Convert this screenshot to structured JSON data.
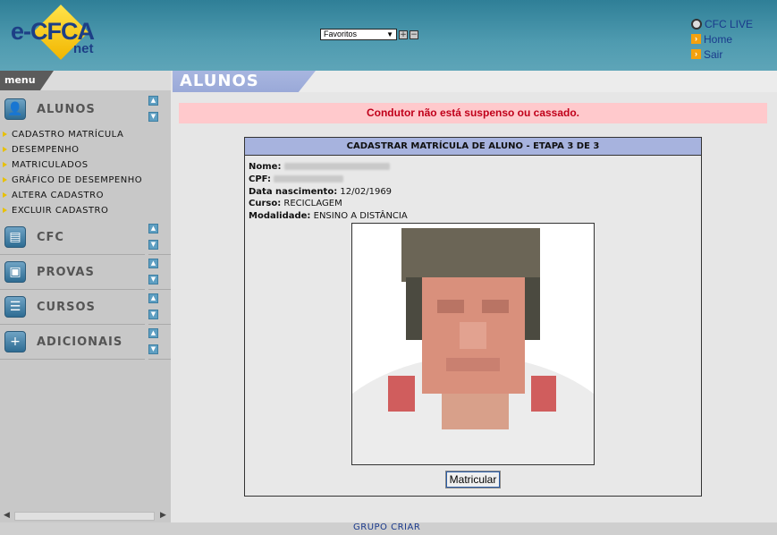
{
  "header": {
    "logo_main": "e-CFCA",
    "logo_sub": "net",
    "favorites_value": "Favoritos",
    "links": [
      "CFC LIVE",
      "Home",
      "Sair"
    ]
  },
  "sidebar": {
    "menu_label": "menu",
    "sections": [
      "ALUNOS",
      "CFC",
      "PROVAS",
      "CURSOS",
      "ADICIONAIS"
    ],
    "alunos_items": [
      "CADASTRO MATRÍCULA",
      "DESEMPENHO",
      "MATRICULADOS",
      "GRÁFICO DE DESEMPENHO",
      "ALTERA CADASTRO",
      "EXCLUIR CADASTRO"
    ]
  },
  "main": {
    "page_title": "ALUNOS",
    "alert": "Condutor não está suspenso ou cassado.",
    "panel_title": "CADASTRAR MATRÍCULA DE ALUNO - ETAPA 3 DE 3",
    "fields": {
      "nome_label": "Nome:",
      "cpf_label": "CPF:",
      "nascimento_label": "Data nascimento:",
      "nascimento_value": "12/02/1969",
      "curso_label": "Curso:",
      "curso_value": "RECICLAGEM",
      "modalidade_label": "Modalidade:",
      "modalidade_value": "ENSINO A DISTÂNCIA"
    },
    "submit_label": "Matricular"
  },
  "footer": {
    "text": "GRUPO CRIAR"
  },
  "colors": {
    "header": "#4f9bb0",
    "alert_bg": "#ffc9cc",
    "alert_text": "#c0001a",
    "panel_title_bg": "#a7b3de"
  }
}
